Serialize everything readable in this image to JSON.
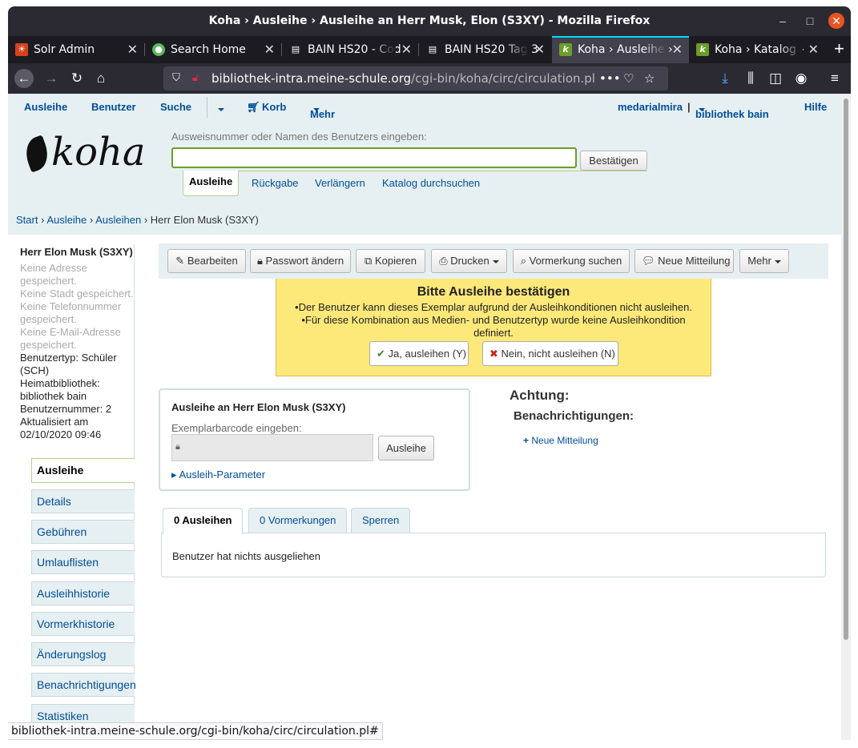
{
  "window": {
    "title": "Koha › Ausleihe › Ausleihe an Herr Musk, Elon (S3XY) - Mozilla Firefox"
  },
  "browser": {
    "tabs": [
      {
        "label": "Solr Admin"
      },
      {
        "label": "Search Home"
      },
      {
        "label": "BAIN HS20 - Cod"
      },
      {
        "label": "BAIN HS20 Tag 3"
      },
      {
        "label": "Koha › Ausleihe ›"
      },
      {
        "label": "Koha › Katalog ›"
      }
    ],
    "url_host": "bibliothek-intra.meine-schule.org",
    "url_path": "/cgi-bin/koha/circ/circulation.pl",
    "status_url": "bibliothek-intra.meine-schule.org/cgi-bin/koha/circ/circulation.pl#"
  },
  "topnav": {
    "ausleihe": "Ausleihe",
    "benutzer": "Benutzer",
    "suche": "Suche",
    "korb": "Korb",
    "mehr": "Mehr",
    "user": "medarialmira",
    "sep": "|",
    "library": "bibliothek bain",
    "hilfe": "Hilfe"
  },
  "header": {
    "logo": "koha",
    "search_label": "Ausweisnummer oder Namen des Benutzers eingeben:",
    "search_value": "",
    "confirm_button": "Bestätigen",
    "subtabs": [
      "Ausleihe",
      "Rückgabe",
      "Verlängern",
      "Katalog durchsuchen"
    ]
  },
  "breadcrumb": {
    "start": "Start",
    "ausleihe": "Ausleihe",
    "ausleihen": "Ausleihen",
    "current": "Herr Elon Musk (S3XY)",
    "sep": "›"
  },
  "patron": {
    "name": "Herr Elon Musk (S3XY)",
    "no_address": "Keine Adresse gespeichert.",
    "no_city": "Keine Stadt gespeichert.",
    "no_phone": "Keine Telefonnummer gespeichert.",
    "no_email": "Keine E-Mail-Adresse gespeichert.",
    "category": "Benutzertyp: Schüler (SCH)",
    "home_library": "Heimatbibliothek: bibliothek bain",
    "number": "Benutzernummer: 2",
    "updated": "Aktualisiert am 02/10/2020 09:46"
  },
  "sidebar": {
    "items": [
      "Ausleihe",
      "Details",
      "Gebühren",
      "Umlauflisten",
      "Ausleihhistorie",
      "Vormerkhistorie",
      "Änderungslog",
      "Benachrichtigungen",
      "Statistiken"
    ]
  },
  "toolbar": {
    "edit": "Bearbeiten",
    "password": "Passwort ändern",
    "copy": "Kopieren",
    "print": "Drucken",
    "search_hold": "Vormerkung suchen",
    "new_message": "Neue Mitteilung",
    "more": "Mehr"
  },
  "dialog": {
    "title": "Bitte Ausleihe bestätigen",
    "messages": [
      "Der Benutzer kann dieses Exemplar aufgrund der Ausleihkonditionen nicht ausleihen.",
      "Für diese Kombination aus Medien- und Benutzertyp wurde keine Ausleihkondition definiert."
    ],
    "yes_button": "Ja, ausleihen (Y)",
    "no_button": "Nein, nicht ausleihen (N)"
  },
  "checkout": {
    "title": "Ausleihe an Herr Elon Musk (S3XY)",
    "barcode_label": "Exemplarbarcode eingeben:",
    "button": "Ausleihe",
    "params_link": "Ausleih-Parameter"
  },
  "attention": {
    "title": "Achtung:",
    "notifications": "Benachrichtigungen:",
    "new_message": "Neue Mitteilung"
  },
  "bottom_tabs": {
    "tabs": [
      "0 Ausleihen",
      "0 Vormerkungen",
      "Sperren"
    ],
    "panel_text": "Benutzer hat nichts ausgeliehen"
  },
  "colors": {
    "accent": "#004d99",
    "header_bg": "#e6f0f2",
    "dialog_bg": "#fde97a",
    "active_border": "#b7d08e"
  }
}
